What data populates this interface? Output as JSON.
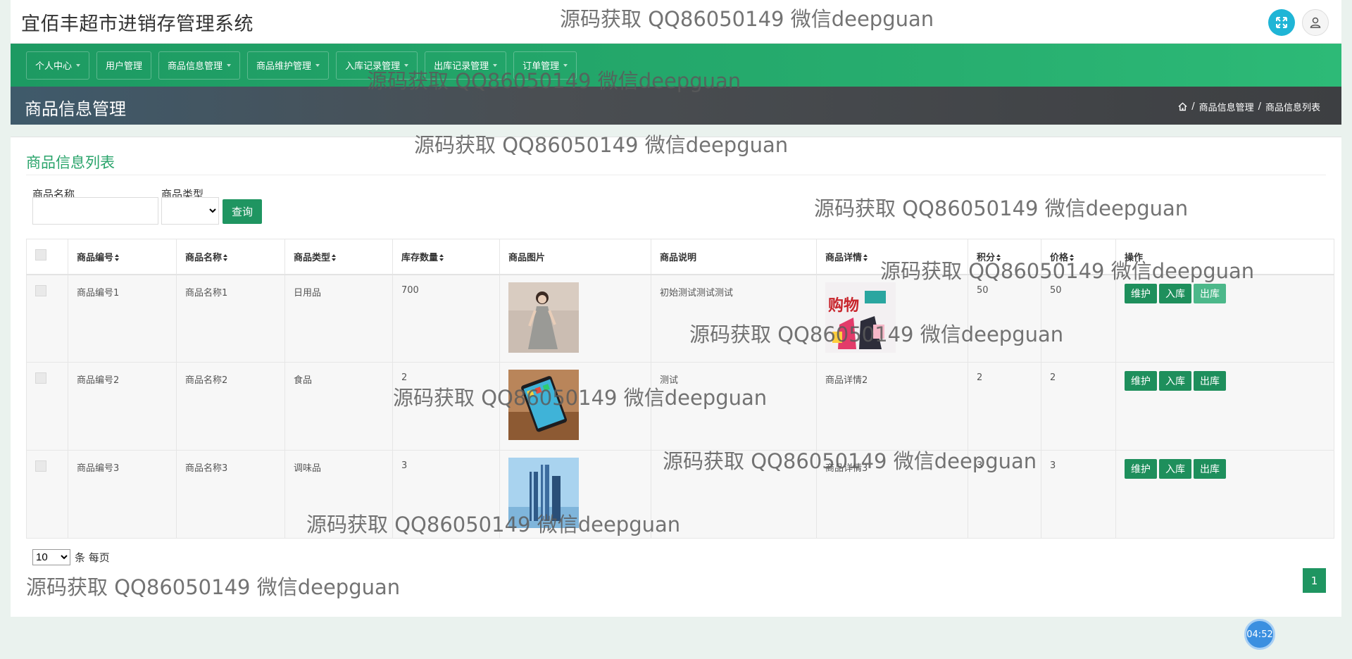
{
  "header": {
    "title": "宜佰丰超市进销存管理系统"
  },
  "nav": {
    "items": [
      {
        "label": "个人中心",
        "dropdown": true
      },
      {
        "label": "用户管理",
        "dropdown": false
      },
      {
        "label": "商品信息管理",
        "dropdown": true
      },
      {
        "label": "商品维护管理",
        "dropdown": true
      },
      {
        "label": "入库记录管理",
        "dropdown": true
      },
      {
        "label": "出库记录管理",
        "dropdown": true
      },
      {
        "label": "订单管理",
        "dropdown": true
      }
    ]
  },
  "page": {
    "title": "商品信息管理",
    "breadcrumb": [
      "商品信息管理",
      "商品信息列表"
    ]
  },
  "list": {
    "title": "商品信息列表",
    "filters": {
      "name_label": "商品名称",
      "name_value": "",
      "type_label": "商品类型",
      "type_value": "",
      "query_label": "查询"
    },
    "columns": [
      "商品编号",
      "商品名称",
      "商品类型",
      "库存数量",
      "商品图片",
      "商品说明",
      "商品详情",
      "积分",
      "价格",
      "操作"
    ],
    "rows": [
      {
        "code": "商品编号1",
        "name": "商品名称1",
        "type": "日用品",
        "stock": "700",
        "image": "dress-photo",
        "desc": "初始测试测试测试",
        "detail": "",
        "detail_image": "shopping-poster",
        "points": "50",
        "price": "50"
      },
      {
        "code": "商品编号2",
        "name": "商品名称2",
        "type": "食品",
        "stock": "2",
        "image": "tablet-photo",
        "desc": "测试",
        "detail": "商品详情2",
        "detail_image": "",
        "points": "2",
        "price": "2"
      },
      {
        "code": "商品编号3",
        "name": "商品名称3",
        "type": "调味品",
        "stock": "3",
        "image": "bottles-photo",
        "desc": "",
        "detail": "商品详情3",
        "detail_image": "",
        "points": "3",
        "price": "3"
      }
    ],
    "actions": {
      "maintain": "维护",
      "inbound": "入库",
      "outbound": "出库"
    },
    "pagination": {
      "page_size": "10",
      "page_size_suffix": "条 每页",
      "current_page": "1"
    }
  },
  "timer": "04:52",
  "watermark_text": "源码获取 QQ86050149 微信deepguan",
  "colors": {
    "accent": "#1f9561",
    "nav": "#27ae6f",
    "title_green": "#2aa46b",
    "header_dark": "#3d3f42"
  }
}
